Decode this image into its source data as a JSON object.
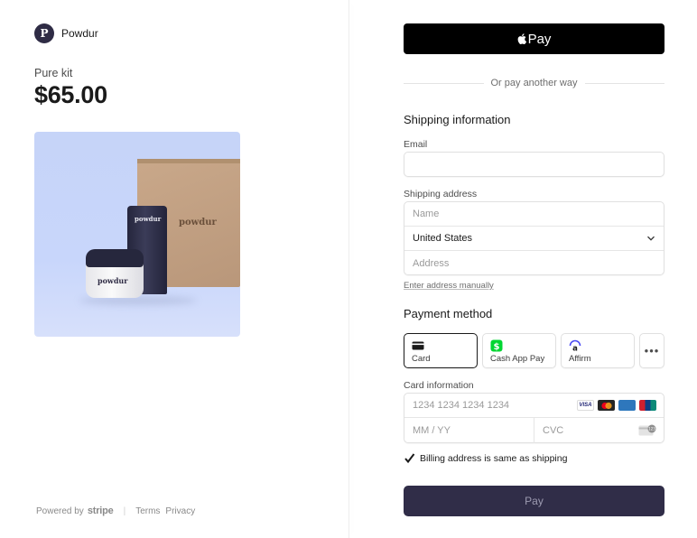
{
  "merchant": {
    "logo_letter": "P",
    "name": "Powdur"
  },
  "product": {
    "name": "Pure kit",
    "price": "$65.00",
    "image_labels": {
      "box": "powdur",
      "tube": "powdur",
      "jar": "powdur"
    }
  },
  "footer": {
    "powered_by": "Powered by",
    "stripe": "stripe",
    "separator": "|",
    "terms": "Terms",
    "privacy": "Privacy"
  },
  "apple_pay": {
    "label": "Pay",
    "icon": "apple-icon"
  },
  "divider_text": "Or pay another way",
  "shipping": {
    "title": "Shipping information",
    "email_label": "Email",
    "email_value": "",
    "address_label": "Shipping address",
    "name_placeholder": "Name",
    "country": "United States",
    "address_placeholder": "Address",
    "manual_link": "Enter address manually"
  },
  "payment": {
    "title": "Payment method",
    "tabs": [
      {
        "label": "Card",
        "icon": "credit-card-icon",
        "active": true
      },
      {
        "label": "Cash App Pay",
        "icon": "cash-app-icon",
        "active": false
      },
      {
        "label": "Affirm",
        "icon": "affirm-icon",
        "active": false
      },
      {
        "label": "•••",
        "icon": "more-icon",
        "active": false
      }
    ],
    "card_info_label": "Card information",
    "card_number_placeholder": "1234 1234 1234 1234",
    "expiry_placeholder": "MM / YY",
    "cvc_placeholder": "CVC",
    "brands": [
      "VISA",
      "Mastercard",
      "AMEX",
      "UnionPay"
    ],
    "billing_same": "Billing address is same as shipping",
    "billing_checked": true,
    "pay_label": "Pay"
  },
  "colors": {
    "accent": "#302d48",
    "apple_pay_bg": "#000000",
    "image_bg": "#c6d4f8"
  }
}
